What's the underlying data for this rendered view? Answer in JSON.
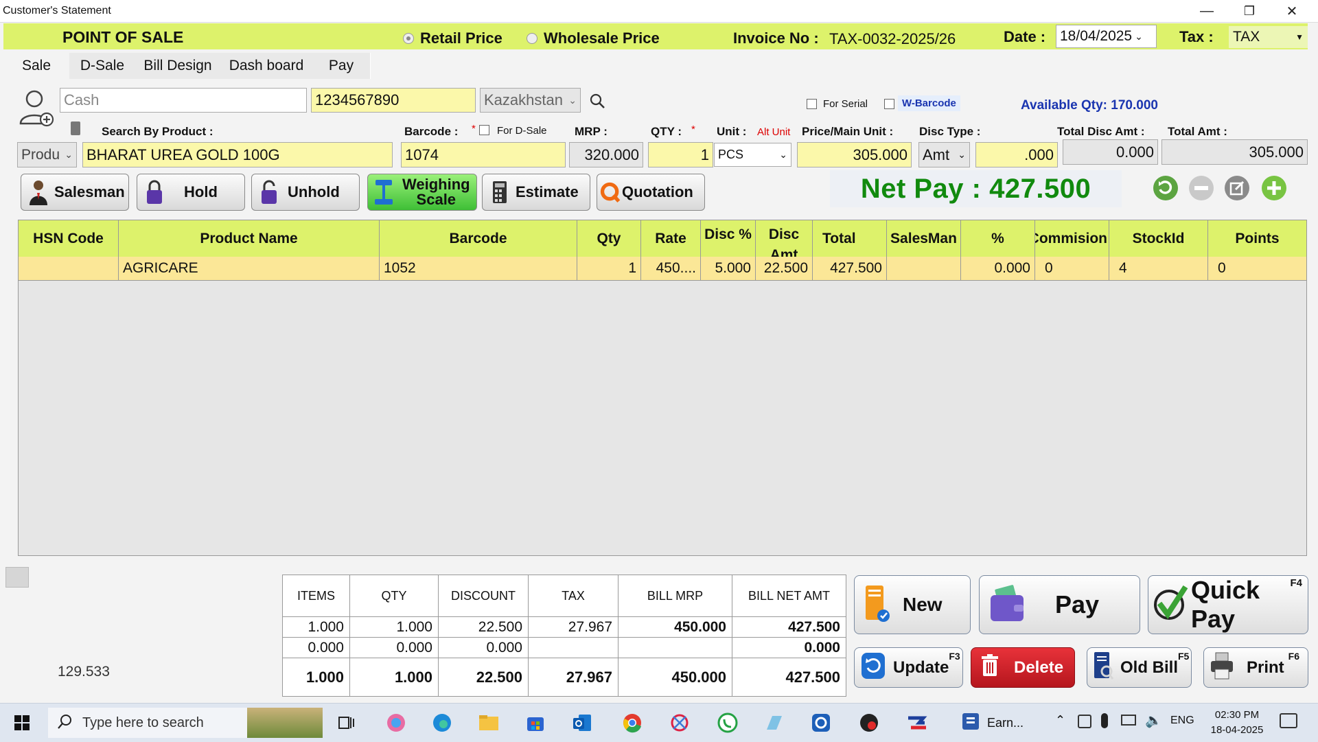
{
  "window": {
    "title": "Customer's Statement"
  },
  "header": {
    "title": "POINT OF SALE",
    "retail_label": "Retail Price",
    "wholesale_label": "Wholesale Price",
    "invoice_label": "Invoice No :",
    "invoice_value": "TAX-0032-2025/26",
    "date_label": "Date :",
    "date_value": "18/04/2025",
    "tax_label": "Tax :",
    "tax_value": "TAX"
  },
  "tabs": [
    "Sale",
    "D-Sale",
    "Bill Design",
    "Dash board",
    "Pay"
  ],
  "customer": {
    "name_placeholder": "Cash",
    "phone": "1234567890",
    "country": "Kazakhstan",
    "for_serial": "For Serial",
    "w_barcode": "W-Barcode",
    "available_qty": "Available Qty: 170.000"
  },
  "entry": {
    "search_label": "Search By Product :",
    "mode": "Produ",
    "product": "BHARAT UREA GOLD 100G",
    "barcode_label": "Barcode :",
    "required_mark": "*",
    "for_dsale": "For D-Sale",
    "barcode": "1074",
    "mrp_label": "MRP :",
    "mrp": "320.000",
    "qty_label": "QTY :",
    "qty": "1",
    "unit_label": "Unit :",
    "alt_unit": "Alt Unit",
    "unit": "PCS",
    "price_label": "Price/Main Unit :",
    "price": "305.000",
    "disc_type_label": "Disc Type :",
    "disc_type": "Amt",
    "disc_value": ".000",
    "total_disc_label": "Total Disc Amt :",
    "total_disc": "0.000",
    "total_amt_label": "Total Amt :",
    "total_amt": "305.000"
  },
  "actions": {
    "salesman": "Salesman",
    "hold": "Hold",
    "unhold": "Unhold",
    "weighing1": "Weighing",
    "weighing2": "Scale",
    "estimate": "Estimate",
    "quotation": "Quotation",
    "net_pay": "Net Pay : 427.500"
  },
  "grid": {
    "headers": [
      "HSN Code",
      "Product Name",
      "Barcode",
      "Qty",
      "Rate",
      "Disc %",
      "Disc Amt",
      "Total",
      "SalesMan",
      "%",
      "Commision",
      "StockId",
      "Points"
    ],
    "rows": [
      [
        "",
        "AGRICARE",
        "1052",
        "1",
        "450....",
        "5.000",
        "22.500",
        "427.500",
        "",
        "0.000",
        "0",
        "4",
        "0"
      ]
    ]
  },
  "footer": {
    "left_value": "129.533",
    "summary_headers": [
      "ITEMS",
      "QTY",
      "DISCOUNT",
      "TAX",
      "BILL MRP",
      "BILL NET AMT"
    ],
    "summary_rows": [
      [
        "1.000",
        "1.000",
        "22.500",
        "27.967",
        "450.000",
        "427.500"
      ],
      [
        "0.000",
        "0.000",
        "0.000",
        "",
        "",
        "0.000"
      ],
      [
        "1.000",
        "1.000",
        "22.500",
        "27.967",
        "450.000",
        "427.500"
      ]
    ],
    "new": "New",
    "pay": "Pay",
    "quick_pay": "Quick Pay",
    "quick_pay_key": "F4",
    "update": "Update",
    "update_key": "F3",
    "delete": "Delete",
    "old_bill": "Old Bill",
    "old_bill_key": "F5",
    "print": "Print",
    "print_key": "F6"
  },
  "taskbar": {
    "search_placeholder": "Type here to search",
    "app_label": "Earn...",
    "lang": "ENG",
    "time": "02:30 PM",
    "date": "18-04-2025"
  },
  "colors": {
    "header_bg": "#ddf26b",
    "row_bg": "#fbe797",
    "net_pay": "#118a0e",
    "available_qty": "#1a35b0"
  }
}
